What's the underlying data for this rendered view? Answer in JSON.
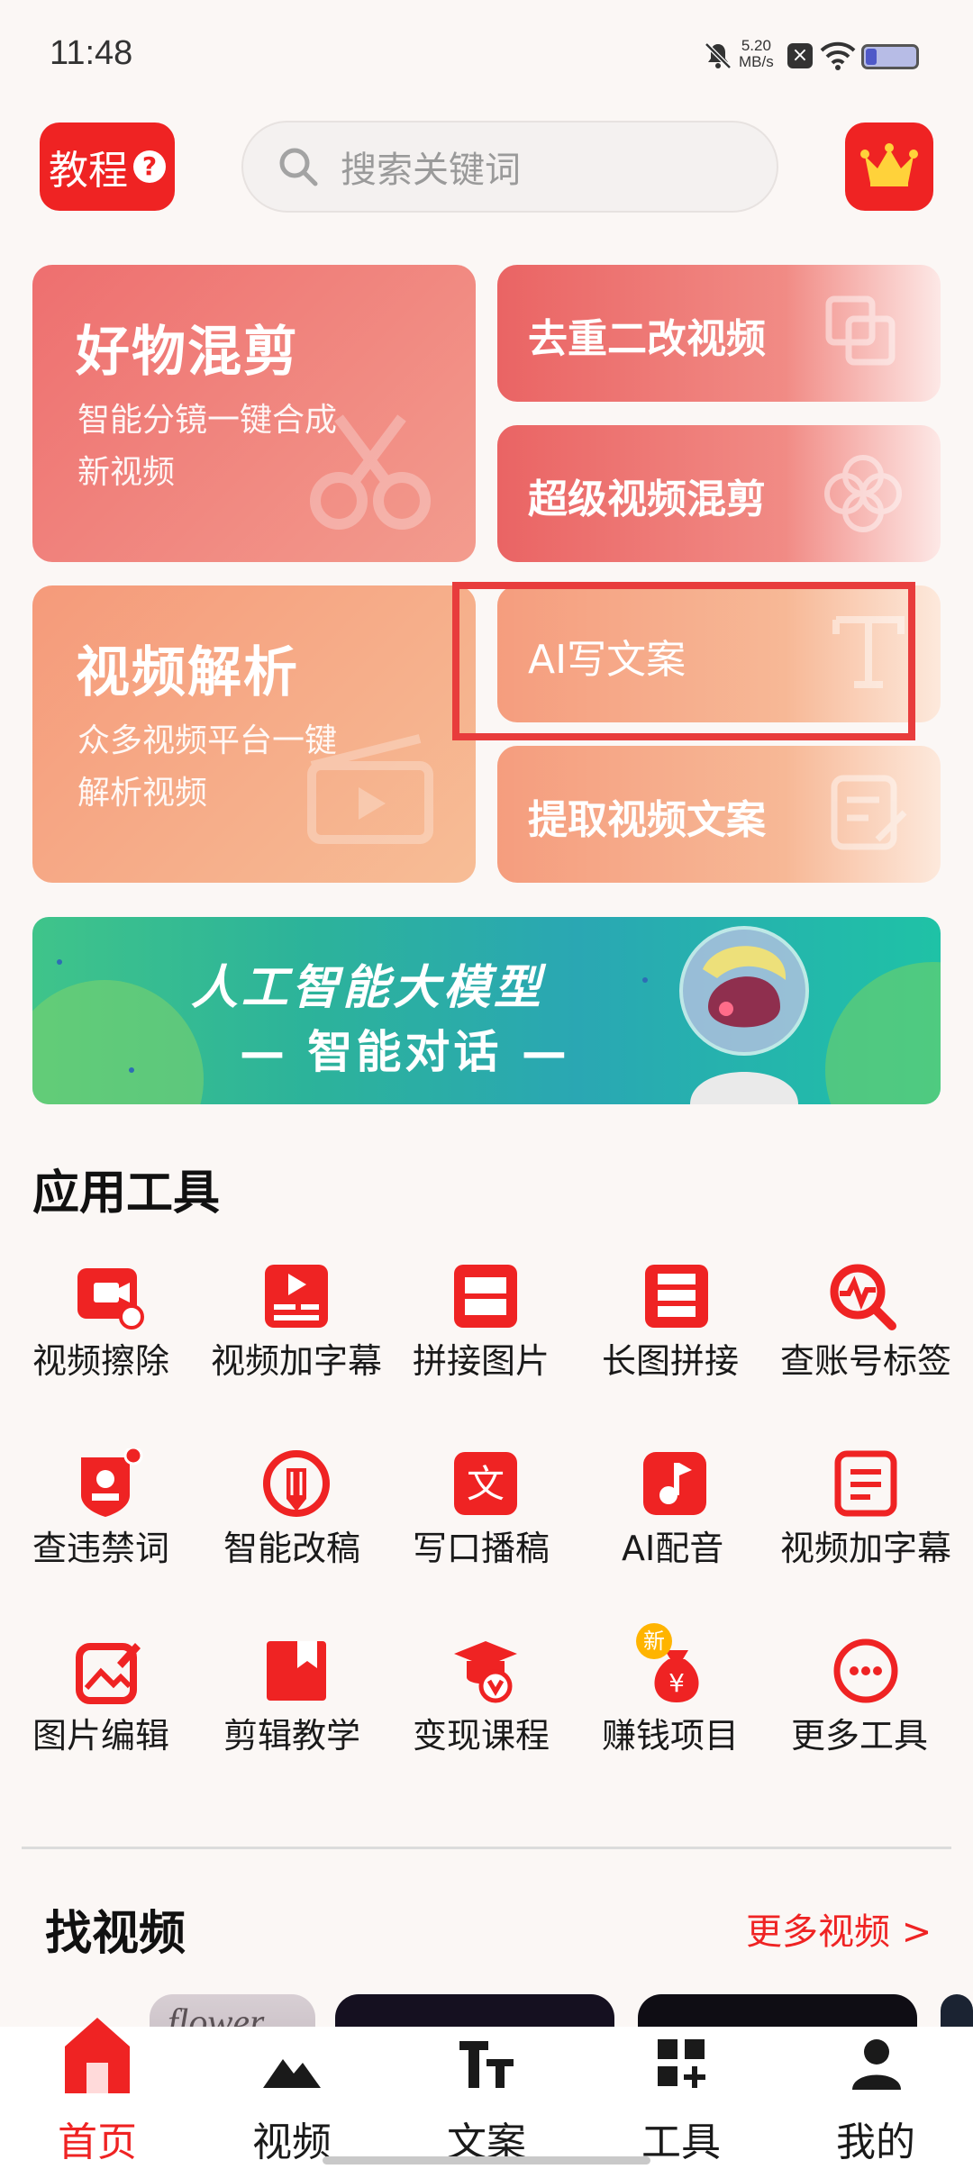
{
  "status_bar": {
    "time": "11:48",
    "net_speed_value": "5.20",
    "net_speed_unit": "MB/s"
  },
  "header": {
    "tutorial_label": "教程",
    "search_placeholder": "搜索关键词"
  },
  "cards": {
    "good_mix": {
      "title": "好物混剪",
      "sub1": "智能分镜一键合成",
      "sub2": "新视频"
    },
    "dedupe": {
      "title": "去重二改视频"
    },
    "super_mix": {
      "title": "超级视频混剪"
    },
    "parse": {
      "title": "视频解析",
      "sub1": "众多视频平台一键",
      "sub2": "解析视频"
    },
    "ai_copy": {
      "title": "AI写文案"
    },
    "extract": {
      "title": "提取视频文案"
    }
  },
  "banner": {
    "line1": "人工智能大模型",
    "line2": "— 智能对话 —"
  },
  "tools_section": {
    "title": "应用工具",
    "items": [
      {
        "label": "视频擦除",
        "icon": "video-erase-icon"
      },
      {
        "label": "视频加字幕",
        "icon": "video-subtitle-icon"
      },
      {
        "label": "拼接图片",
        "icon": "image-stitch-icon"
      },
      {
        "label": "长图拼接",
        "icon": "long-image-icon"
      },
      {
        "label": "查账号标签",
        "icon": "account-tag-search-icon"
      },
      {
        "label": "查违禁词",
        "icon": "forbidden-words-icon"
      },
      {
        "label": "智能改稿",
        "icon": "smart-rewrite-icon"
      },
      {
        "label": "写口播稿",
        "icon": "script-write-icon"
      },
      {
        "label": "AI配音",
        "icon": "ai-dubbing-icon"
      },
      {
        "label": "视频加字幕",
        "icon": "subtitle-doc-icon"
      },
      {
        "label": "图片编辑",
        "icon": "image-edit-icon"
      },
      {
        "label": "剪辑教学",
        "icon": "edit-tutorial-icon"
      },
      {
        "label": "变现课程",
        "icon": "monetize-course-icon"
      },
      {
        "label": "赚钱项目",
        "icon": "money-bag-icon"
      },
      {
        "label": "更多工具",
        "icon": "more-icon"
      }
    ],
    "new_badge": "新"
  },
  "find_video": {
    "title": "找视频",
    "more": "更多视频 >",
    "thumb_text": "flower"
  },
  "bottom_nav": {
    "items": [
      {
        "label": "首页",
        "icon": "home-icon",
        "active": true
      },
      {
        "label": "视频",
        "icon": "mountain-icon",
        "active": false
      },
      {
        "label": "文案",
        "icon": "text-icon",
        "active": false
      },
      {
        "label": "工具",
        "icon": "grid-plus-icon",
        "active": false
      },
      {
        "label": "我的",
        "icon": "person-icon",
        "active": false
      }
    ]
  },
  "colors": {
    "brand_red": "#ef2323",
    "banner_green": "#2cb39a"
  }
}
